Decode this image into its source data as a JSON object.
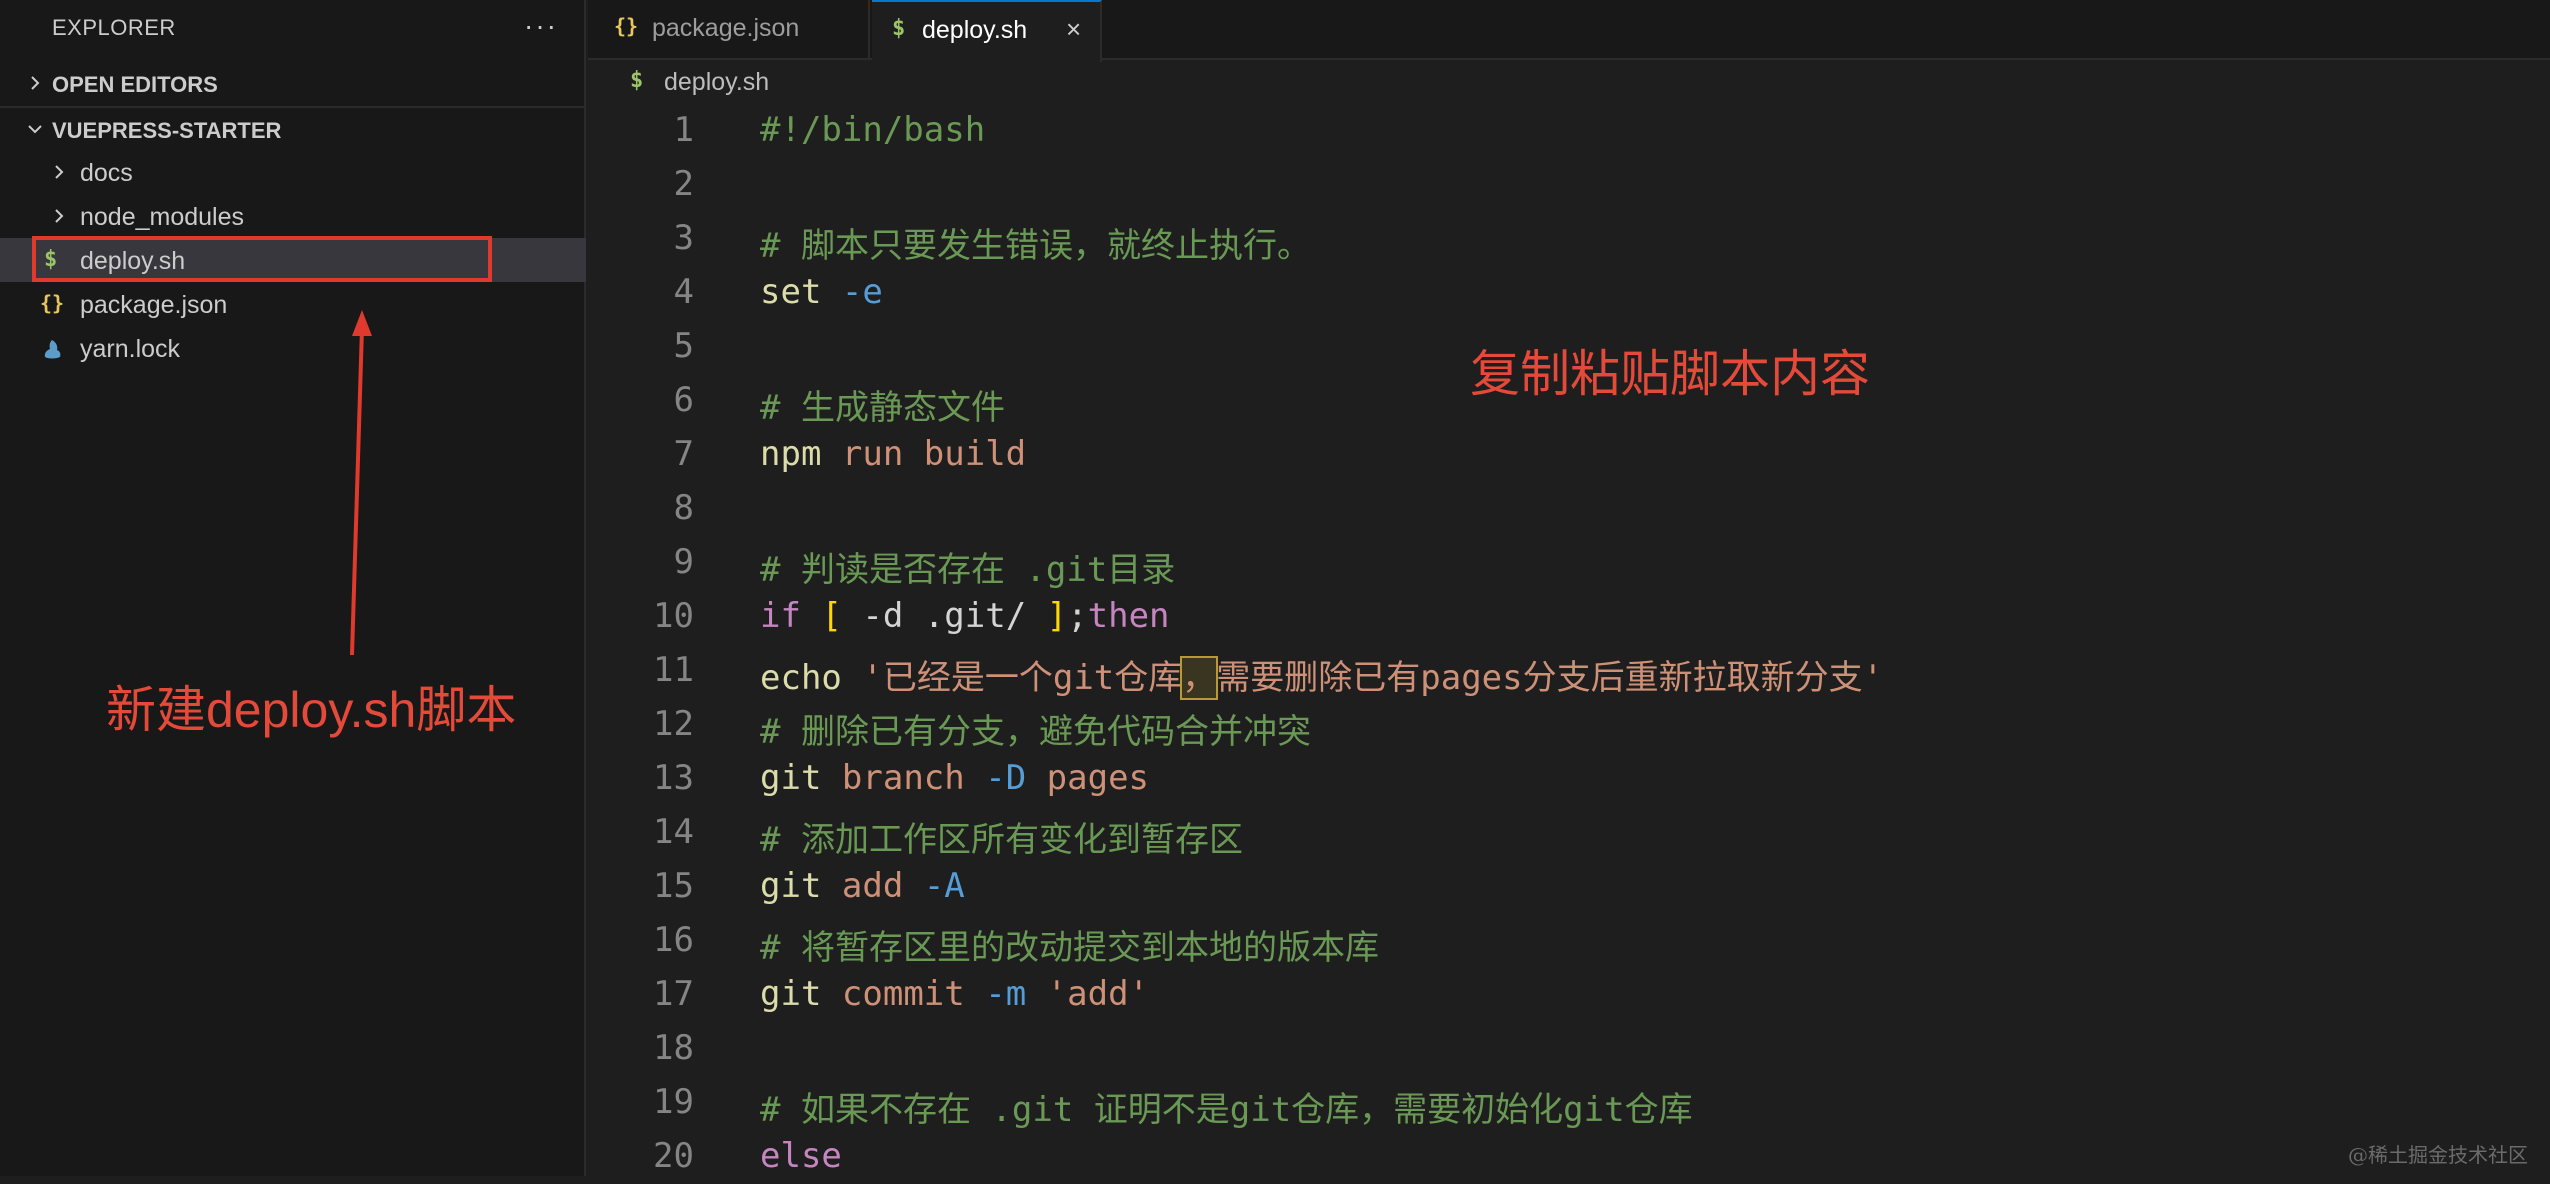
{
  "explorer": {
    "title": "EXPLORER",
    "more": "···",
    "sections": {
      "open_editors": "OPEN EDITORS",
      "project": "VUEPRESS-STARTER"
    },
    "tree": [
      {
        "name": "docs",
        "type": "folder"
      },
      {
        "name": "node_modules",
        "type": "folder"
      },
      {
        "name": "deploy.sh",
        "type": "shell",
        "icon": "$",
        "selected": true
      },
      {
        "name": "package.json",
        "type": "json",
        "icon": "{}"
      },
      {
        "name": "yarn.lock",
        "type": "yarn"
      }
    ]
  },
  "tabs": [
    {
      "label": "package.json",
      "icon": "{}",
      "active": false
    },
    {
      "label": "deploy.sh",
      "icon": "$",
      "active": true,
      "close": "×"
    }
  ],
  "breadcrumb": {
    "icon": "$",
    "label": "deploy.sh"
  },
  "editor": {
    "line_numbers": [
      "1",
      "2",
      "3",
      "4",
      "5",
      "6",
      "7",
      "8",
      "9",
      "10",
      "11",
      "12",
      "13",
      "14",
      "15",
      "16",
      "17",
      "18",
      "19",
      "20"
    ],
    "lines": [
      "#!/bin/bash",
      "",
      "# 脚本只要发生错误，就终止执行。",
      "set -e",
      "",
      "# 生成静态文件",
      "npm run build",
      "",
      "# 判读是否存在 .git目录",
      "if [ -d .git/ ];then",
      "echo '已经是一个git仓库，需要删除已有pages分支后重新拉取新分支'",
      "# 删除已有分支，避免代码合并冲突",
      "git branch -D pages",
      "# 添加工作区所有变化到暂存区",
      "git add -A",
      "# 将暂存区里的改动提交到本地的版本库",
      "git commit -m 'add'",
      "",
      "# 如果不存在 .git 证明不是git仓库，需要初始化git仓库",
      "else"
    ],
    "tokens": {
      "l1": "#!/bin/bash",
      "l3": "# 脚本只要发生错误，就终止执行。",
      "l4a": "set",
      "l4b": "-e",
      "l6": "# 生成静态文件",
      "l7a": "npm",
      "l7b": "run build",
      "l9": "# 判读是否存在 .git目录",
      "l10a": "if",
      "l10b": "[",
      "l10c": "-d .git/",
      "l10d": "]",
      "l10e": ";",
      "l10f": "then",
      "l11a": "echo",
      "l11b": "'已经是一个git仓库",
      "l11c": "，",
      "l11d": "需要删除已有pages分支后重新拉取新分支'",
      "l12": "# 删除已有分支，避免代码合并冲突",
      "l13a": "git",
      "l13b": "branch",
      "l13c": "-D",
      "l13d": "pages",
      "l14": "# 添加工作区所有变化到暂存区",
      "l15a": "git",
      "l15b": "add",
      "l15c": "-A",
      "l16": "# 将暂存区里的改动提交到本地的版本库",
      "l17a": "git",
      "l17b": "commit",
      "l17c": "-m",
      "l17d": "'add'",
      "l19": "# 如果不存在 .git 证明不是git仓库，需要初始化git仓库",
      "l20": "else"
    }
  },
  "annotations": {
    "left": "新建deploy.sh脚本",
    "right": "复制粘贴脚本内容",
    "color": "#e34a3a"
  },
  "watermark": "@稀土掘金技术社区",
  "colors": {
    "comment": "#6a9955",
    "command": "#dcdcaa",
    "string": "#ce9178",
    "flag": "#569cd6",
    "keyword": "#c586c0",
    "accent": "#0078d4"
  }
}
